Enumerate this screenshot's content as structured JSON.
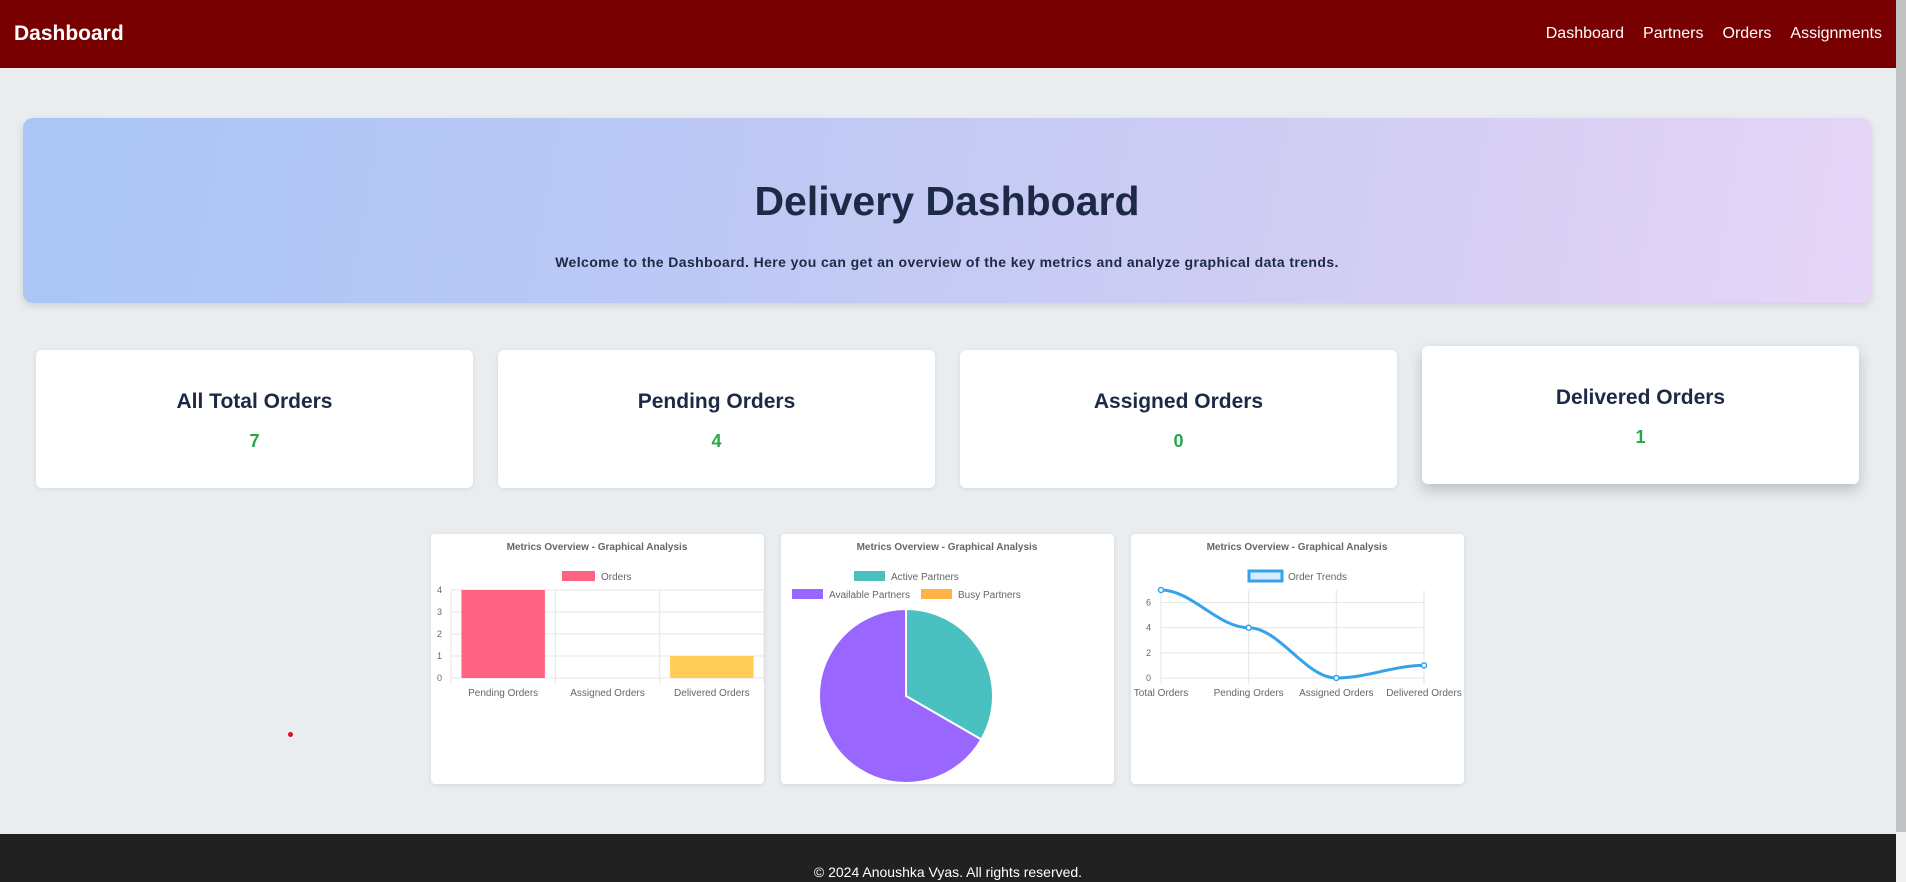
{
  "navbar": {
    "brand": "Dashboard",
    "links": [
      "Dashboard",
      "Partners",
      "Orders",
      "Assignments"
    ]
  },
  "hero": {
    "title": "Delivery Dashboard",
    "description": "Welcome to the Dashboard. Here you can get an overview of the key metrics and analyze graphical data trends."
  },
  "metrics": [
    {
      "title": "All Total Orders",
      "value": "7"
    },
    {
      "title": "Pending Orders",
      "value": "4"
    },
    {
      "title": "Assigned Orders",
      "value": "0"
    },
    {
      "title": "Delivered Orders",
      "value": "1"
    }
  ],
  "colors": {
    "navbar": "#790000",
    "accent_value": "#27a74a",
    "footer": "#212121"
  },
  "chart_data": [
    {
      "type": "bar",
      "title": "Metrics Overview - Graphical Analysis",
      "categories": [
        "Pending Orders",
        "Assigned Orders",
        "Delivered Orders"
      ],
      "series": [
        {
          "name": "Orders",
          "values": [
            4,
            0,
            1
          ]
        }
      ],
      "bar_colors": [
        "#ff6384",
        "#36a2eb",
        "#ffcd56"
      ],
      "ylim": [
        0,
        4
      ],
      "yticks": [
        0,
        1,
        2,
        3,
        4
      ],
      "legend": "top",
      "grid": true
    },
    {
      "type": "pie",
      "title": "Metrics Overview - Graphical Analysis",
      "labels": [
        "Active Partners",
        "Available Partners",
        "Busy Partners"
      ],
      "values": [
        1,
        2,
        0
      ],
      "colors": [
        "#4bc0c0",
        "#9966ff",
        "#ffb246"
      ],
      "legend": "top"
    },
    {
      "type": "line",
      "title": "Metrics Overview - Graphical Analysis",
      "categories": [
        "Total Orders",
        "Pending Orders",
        "Assigned Orders",
        "Delivered Orders"
      ],
      "series": [
        {
          "name": "Order Trends",
          "values": [
            7,
            4,
            0,
            1
          ]
        }
      ],
      "color": "#36a2eb",
      "ylim": [
        0,
        7
      ],
      "yticks": [
        0,
        2,
        4,
        6
      ],
      "legend": "top",
      "grid": true
    }
  ],
  "footer": {
    "text": "© 2024 Anoushka Vyas. All rights reserved."
  }
}
